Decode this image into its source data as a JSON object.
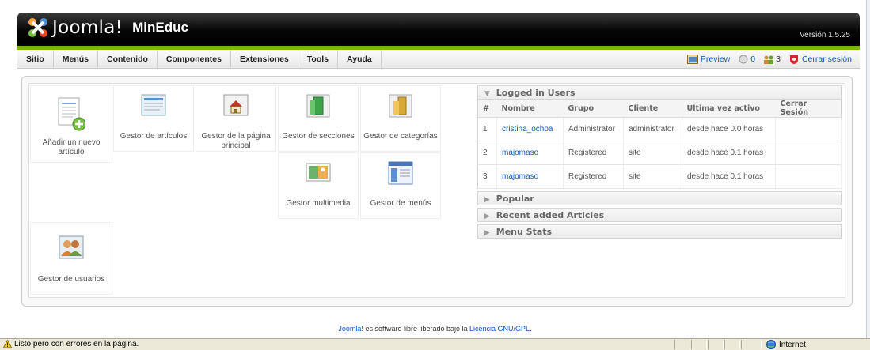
{
  "header": {
    "logo_text": "Joomla!",
    "site_name": "MinEduc",
    "version": "Versión 1.5.25"
  },
  "menu": {
    "items": [
      "Sitio",
      "Menús",
      "Contenido",
      "Componentes",
      "Extensiones",
      "Tools",
      "Ayuda"
    ],
    "preview_label": "Preview",
    "messages_count": "0",
    "users_count": "3",
    "logout_label": "Cerrar sesión"
  },
  "cpanel": {
    "buttons": [
      {
        "label": "Añadir un nuevo artículo",
        "icon": "add-article-icon"
      },
      {
        "label": "Gestor de artículos",
        "icon": "article-manager-icon"
      },
      {
        "label": "Gestor de la página principal",
        "icon": "frontpage-manager-icon"
      },
      {
        "label": "Gestor de secciones",
        "icon": "section-manager-icon"
      },
      {
        "label": "Gestor de categorías",
        "icon": "category-manager-icon"
      },
      {
        "label": "Gestor multimedia",
        "icon": "media-manager-icon"
      },
      {
        "label": "Gestor de menús",
        "icon": "menu-manager-icon"
      },
      {
        "label": "Gestor de usuarios",
        "icon": "user-manager-icon"
      }
    ]
  },
  "logged_users": {
    "title": "Logged in Users",
    "columns": [
      "#",
      "Nombre",
      "Grupo",
      "Cliente",
      "Última vez activo",
      "Cerrar Sesión"
    ],
    "rows": [
      {
        "n": "1",
        "name": "cristina_ochoa",
        "group": "Administrator",
        "client": "administrator",
        "last": "desde hace 0.0 horas",
        "logout": ""
      },
      {
        "n": "2",
        "name": "majomaso",
        "group": "Registered",
        "client": "site",
        "last": "desde hace 0.1 horas",
        "logout": ""
      },
      {
        "n": "3",
        "name": "majomaso",
        "group": "Registered",
        "client": "site",
        "last": "desde hace 0.1 horas",
        "logout": ""
      }
    ]
  },
  "panels": {
    "popular": "Popular",
    "recent": "Recent added Articles",
    "menu_stats": "Menu Stats"
  },
  "footer": {
    "link_joomla": "Joomla!",
    "text": "es software libre liberado bajo la",
    "link_license": "Licencia GNU/GPL",
    "tail": "."
  },
  "statusbar": {
    "message": "Listo pero con errores en la página.",
    "zone": "Internet"
  },
  "colors": {
    "accent_green": "#7ab800",
    "link_blue": "#0b55c4",
    "header_dark": "#000000"
  }
}
